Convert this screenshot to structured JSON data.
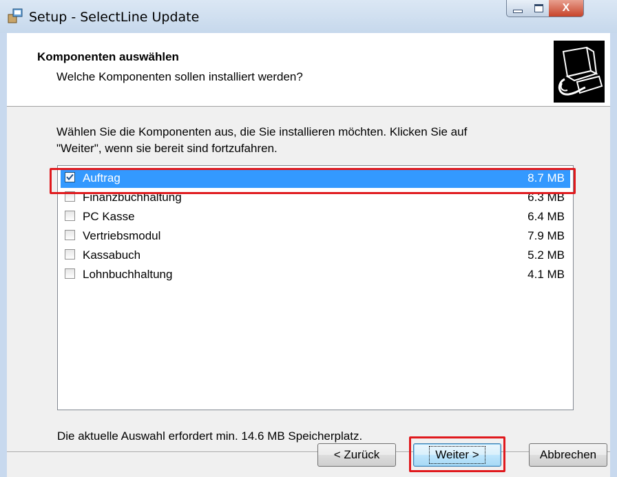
{
  "window": {
    "title": "Setup - SelectLine Update",
    "close_glyph": "X"
  },
  "header": {
    "title": "Komponenten auswählen",
    "subtitle": "Welche Komponenten sollen installiert werden?"
  },
  "instruction": {
    "line1": "Wählen Sie die Komponenten aus, die Sie installieren möchten. Klicken Sie auf",
    "line2": "\"Weiter\", wenn sie bereit sind fortzufahren."
  },
  "components": [
    {
      "label": "Auftrag",
      "size": "8.7 MB",
      "checked": true,
      "selected": true
    },
    {
      "label": "Finanzbuchhaltung",
      "size": "6.3 MB",
      "checked": false,
      "selected": false
    },
    {
      "label": "PC Kasse",
      "size": "6.4 MB",
      "checked": false,
      "selected": false
    },
    {
      "label": "Vertriebsmodul",
      "size": "7.9 MB",
      "checked": false,
      "selected": false
    },
    {
      "label": "Kassabuch",
      "size": "5.2 MB",
      "checked": false,
      "selected": false
    },
    {
      "label": "Lohnbuchhaltung",
      "size": "4.1 MB",
      "checked": false,
      "selected": false
    }
  ],
  "status": "Die aktuelle Auswahl erfordert min. 14.6 MB Speicherplatz.",
  "buttons": {
    "back": "< Zurück",
    "next": "Weiter >",
    "cancel": "Abbrechen"
  },
  "colors": {
    "selection": "#3399ff",
    "highlight_annotation": "#e0191d"
  },
  "icons": {
    "app": "installer-icon",
    "wizard": "computer-install-icon",
    "check": "checkmark-icon"
  }
}
